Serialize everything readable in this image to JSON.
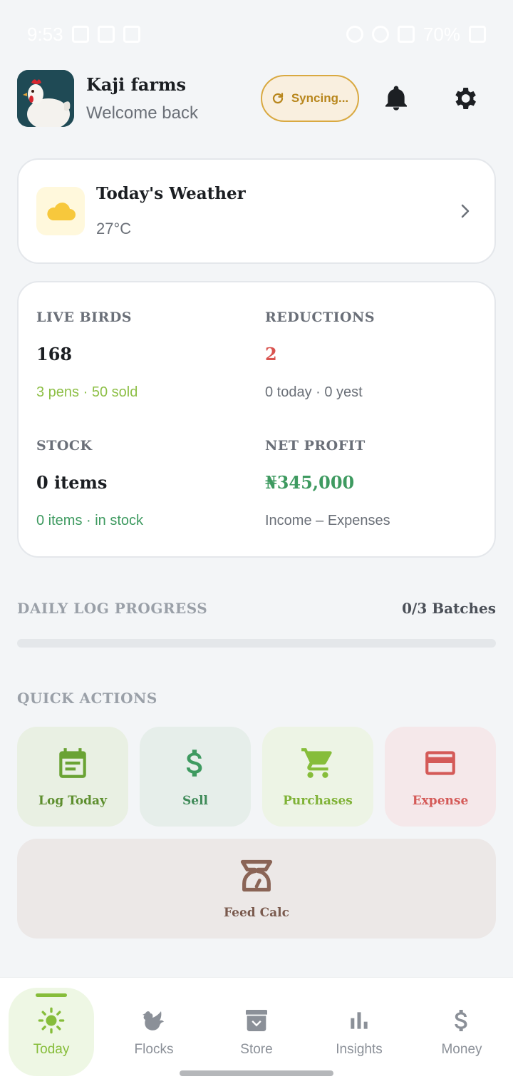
{
  "status_bar": {
    "time": "9:53",
    "battery": "70%"
  },
  "header": {
    "farm_name": "Kaji farms",
    "welcome": "Welcome back",
    "sync_label": "Syncing..."
  },
  "weather": {
    "title": "Today's Weather",
    "temperature": "27°C"
  },
  "stats": {
    "live_birds": {
      "label": "LIVE BIRDS",
      "value": "168",
      "sub": "3 pens · 50 sold"
    },
    "reductions": {
      "label": "REDUCTIONS",
      "value": "2",
      "sub": "0 today · 0 yest"
    },
    "stock": {
      "label": "STOCK",
      "value": "0 items",
      "sub": "0 items · in stock"
    },
    "net_profit": {
      "label": "NET PROFIT",
      "value": "₦345,000",
      "sub": "Income – Expenses"
    }
  },
  "daily_log": {
    "label": "DAILY LOG PROGRESS",
    "batches": "0/3 Batches",
    "progress": 0
  },
  "quick_actions": {
    "label": "QUICK ACTIONS",
    "log_today": "Log Today",
    "sell": "Sell",
    "purchases": "Purchases",
    "expense": "Expense",
    "feed_calc": "Feed Calc"
  },
  "nav": {
    "today": "Today",
    "flocks": "Flocks",
    "store": "Store",
    "insights": "Insights",
    "money": "Money"
  },
  "colors": {
    "accent_green": "#86bd3a",
    "profit_green": "#3e9a60",
    "reduction_red": "#d9534f",
    "sync_amber": "#d9a941",
    "expense_red": "#d45a58",
    "feed_brown": "#8a6456"
  },
  "icons": {
    "sync": "refresh-icon",
    "bell": "bell-icon",
    "settings": "gear-icon",
    "weather": "cloud-icon",
    "log_today": "calendar-icon",
    "sell": "dollar-icon",
    "purchases": "cart-icon",
    "expense": "credit-card-icon",
    "feed_calc": "scale-icon",
    "today": "sun-icon",
    "flocks": "chicken-icon",
    "store": "archive-icon",
    "insights": "bar-chart-icon",
    "money": "dollar-icon"
  }
}
